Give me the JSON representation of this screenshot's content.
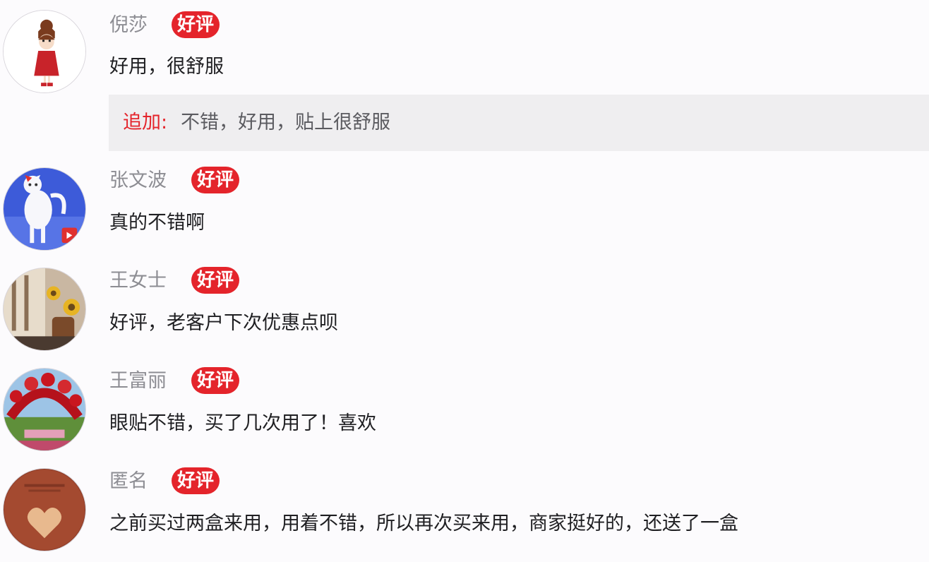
{
  "reviews": [
    {
      "username": "倪莎",
      "badge": "好评",
      "text": "好用，很舒服",
      "append": {
        "label": "追加:",
        "text": "不错，好用，贴上很舒服"
      },
      "avatar": "girl-cartoon-avatar"
    },
    {
      "username": "张文波",
      "badge": "好评",
      "text": "真的不错啊",
      "avatar": "white-cat-avatar"
    },
    {
      "username": "王女士",
      "badge": "好评",
      "text": "好评，老客户下次优惠点呗",
      "avatar": "sunflower-room-avatar"
    },
    {
      "username": "王富丽",
      "badge": "好评",
      "text": "眼贴不错，买了几次用了！喜欢",
      "avatar": "flower-garden-avatar"
    },
    {
      "username": "匿名",
      "badge": "好评",
      "text": "之前买过两盒来用，用着不错，所以再次买来用，商家挺好的，还送了一盒",
      "avatar": "heart-card-avatar"
    }
  ],
  "colors": {
    "badge": "#e4242b",
    "append_label": "#e4242b",
    "username": "#8d8d93",
    "text": "#1f1f22",
    "append_bg": "#efeef0"
  }
}
